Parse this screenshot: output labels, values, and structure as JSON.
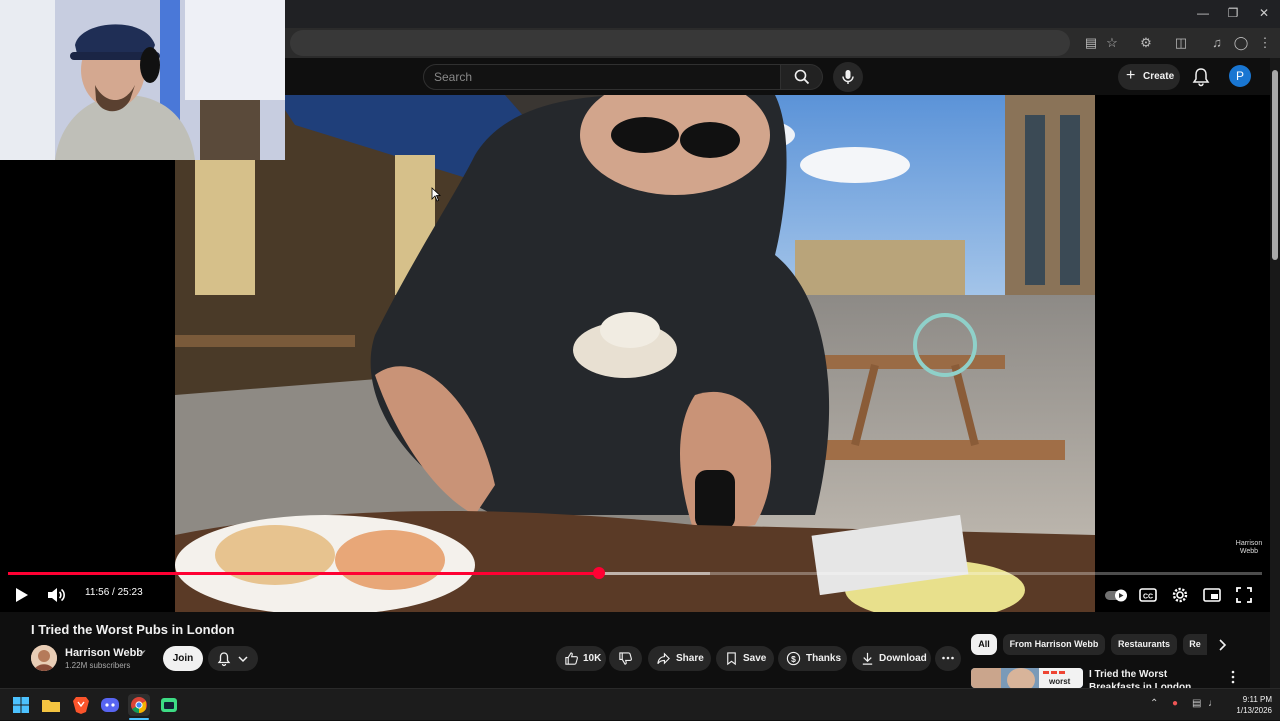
{
  "browser": {
    "window_controls": [
      "minimize",
      "restore",
      "close"
    ]
  },
  "header": {
    "search_placeholder": "Search",
    "create_label": "Create",
    "avatar_initial": "P"
  },
  "player": {
    "time": "11:56 / 25:23",
    "progress_fraction": 0.471,
    "buffer_fraction": 0.56,
    "watermark": "Harrison Webb",
    "state": "paused"
  },
  "video": {
    "title": "I Tried the Worst Pubs in London",
    "channel_name": "Harrison Webb",
    "subscribers": "1.22M subscribers",
    "join_label": "Join",
    "likes": "10K",
    "share_label": "Share",
    "save_label": "Save",
    "thanks_label": "Thanks",
    "download_label": "Download"
  },
  "chips": [
    "All",
    "From Harrison Webb",
    "Restaurants",
    "Re"
  ],
  "recommendation": {
    "title": "I Tried the Worst Breakfasts in London",
    "thumb_text": "worst"
  },
  "taskbar": {
    "time": "9:11 PM",
    "date": "1/13/2026"
  },
  "colors": {
    "accent_red": "#ff0033",
    "background": "#0f0f0f",
    "chip_bg": "#272727"
  }
}
